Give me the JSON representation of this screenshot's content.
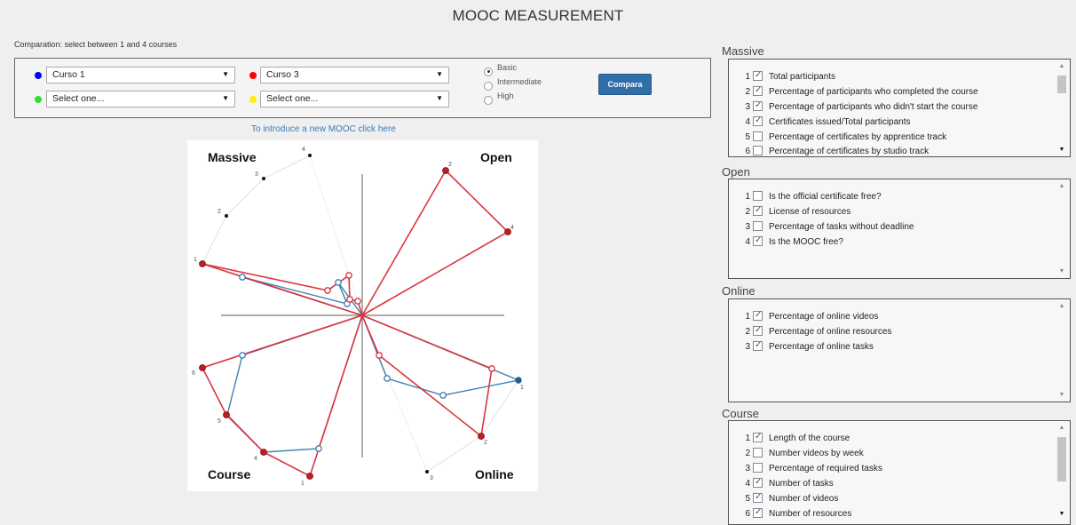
{
  "title": "MOOC MEASUREMENT",
  "comparison_instruction": "Comparation: select between 1 and 4 courses",
  "course_selects": [
    {
      "value": "Curso 1",
      "dot_color": "#0000ff"
    },
    {
      "value": "Curso 3",
      "dot_color": "#ff0000"
    },
    {
      "value": "Select one...",
      "dot_color": "#33dd33"
    },
    {
      "value": "Select one...",
      "dot_color": "#ffee00"
    }
  ],
  "levels": [
    {
      "label": "Basic",
      "selected": true
    },
    {
      "label": "Intermediate",
      "selected": false
    },
    {
      "label": "High",
      "selected": false
    }
  ],
  "compare_button": "Compara",
  "new_mooc_link": "To introduce a new MOOC click here",
  "chart": {
    "quadrants": [
      "Massive",
      "Open",
      "Course",
      "Online"
    ]
  },
  "sections": [
    {
      "label": "Massive",
      "items": [
        {
          "num": "1",
          "checked": true,
          "label": "Total participants"
        },
        {
          "num": "2",
          "checked": true,
          "label": "Percentage of participants who completed the course"
        },
        {
          "num": "3",
          "checked": true,
          "label": "Percentage of participants who didn't start the course"
        },
        {
          "num": "4",
          "checked": true,
          "label": "Certificates issued/Total participants"
        },
        {
          "num": "5",
          "checked": false,
          "label": "Percentage of certificates by apprentice track"
        },
        {
          "num": "6",
          "checked": false,
          "label": "Percentage of certificates by studio track"
        }
      ]
    },
    {
      "label": "Open",
      "items": [
        {
          "num": "1",
          "checked": false,
          "label": "Is the official certificate free?"
        },
        {
          "num": "2",
          "checked": true,
          "label": "License of resources"
        },
        {
          "num": "3",
          "checked": false,
          "label": "Percentage of tasks without deadline"
        },
        {
          "num": "4",
          "checked": true,
          "label": "Is the MOOC free?"
        }
      ]
    },
    {
      "label": "Online",
      "items": [
        {
          "num": "1",
          "checked": true,
          "label": "Percentage of online videos"
        },
        {
          "num": "2",
          "checked": true,
          "label": "Percentage of online resources"
        },
        {
          "num": "3",
          "checked": true,
          "label": "Percentage of online tasks"
        }
      ]
    },
    {
      "label": "Course",
      "items": [
        {
          "num": "1",
          "checked": true,
          "label": "Length of the course"
        },
        {
          "num": "2",
          "checked": false,
          "label": "Number videos by week"
        },
        {
          "num": "3",
          "checked": false,
          "label": "Percentage of required tasks"
        },
        {
          "num": "4",
          "checked": true,
          "label": "Number of tasks"
        },
        {
          "num": "5",
          "checked": true,
          "label": "Number of videos"
        },
        {
          "num": "6",
          "checked": true,
          "label": "Number of resources"
        }
      ]
    }
  ]
}
